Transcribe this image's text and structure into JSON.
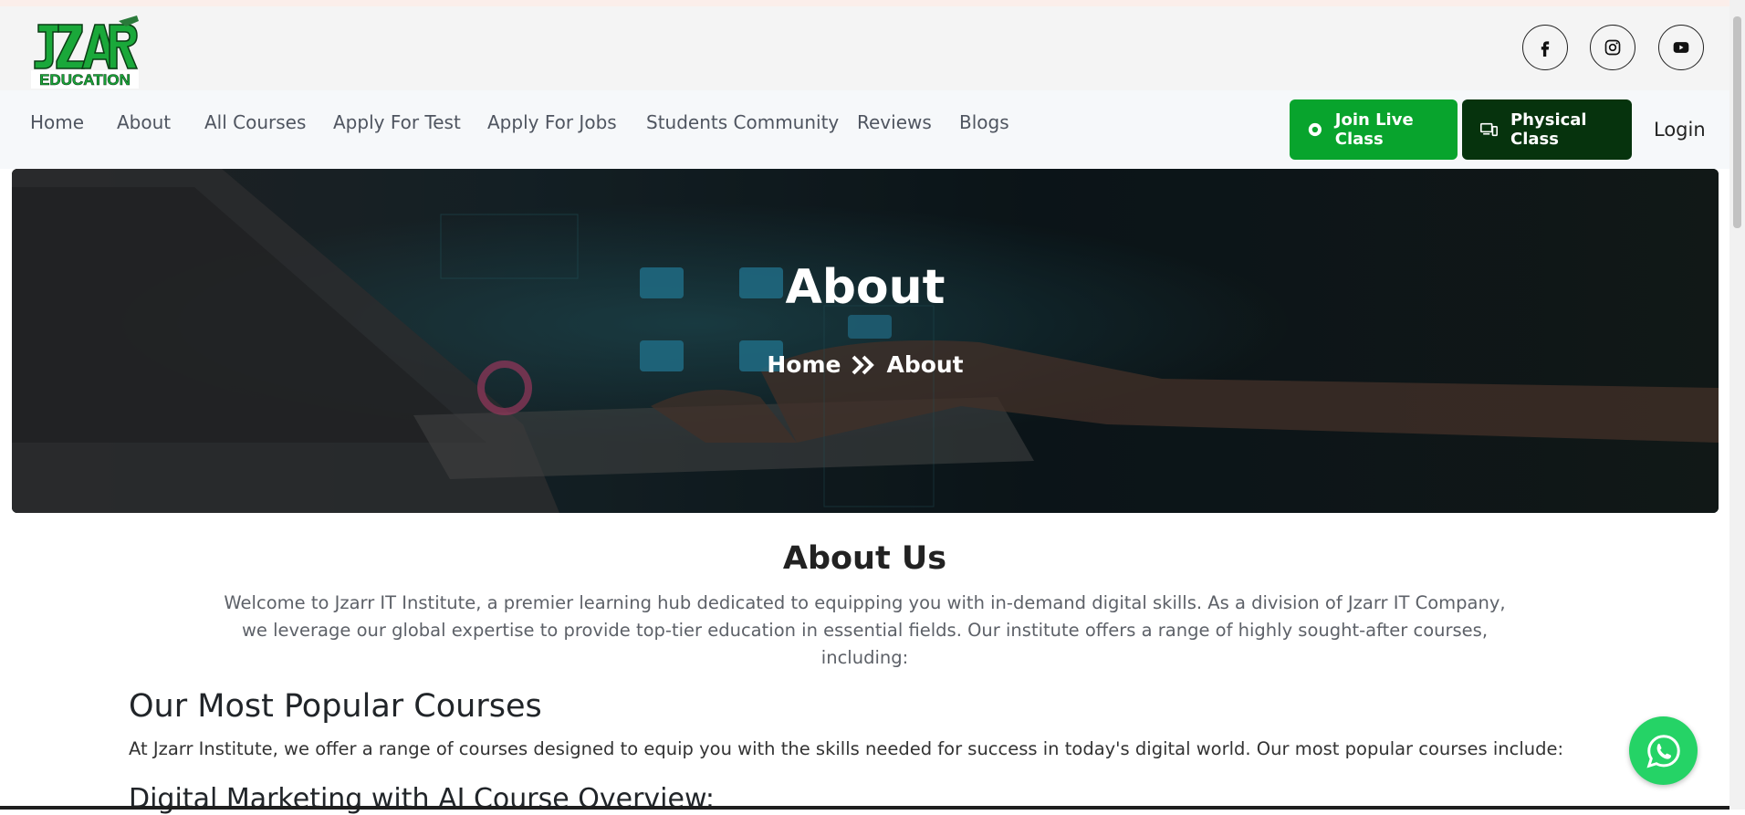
{
  "brand": {
    "logo_main": "JZARR",
    "logo_sub": "EDUCATION"
  },
  "social": [
    {
      "icon": "facebook-icon"
    },
    {
      "icon": "instagram-icon"
    },
    {
      "icon": "youtube-icon"
    }
  ],
  "nav": {
    "items": [
      "Home",
      "About",
      "All Courses",
      "Apply For Test",
      "Apply For Jobs",
      "Students Community",
      "Reviews",
      "Blogs"
    ],
    "live_label": "Join Live Class",
    "physical_label": "Physical Class",
    "login_label": "Login"
  },
  "hero": {
    "title": "About",
    "breadcrumb_home": "Home",
    "breadcrumb_current": "About"
  },
  "about": {
    "title": "About Us",
    "line1": "Welcome to Jzarr IT Institute, a premier learning hub dedicated to equipping you with in-demand digital skills. As a division of Jzarr IT Company,",
    "line2": "we leverage our global expertise to provide top-tier education in essential fields. Our institute offers a range of highly sought-after courses, including:"
  },
  "popular": {
    "title": "Our Most Popular Courses",
    "text": "At Jzarr Institute, we offer a range of courses designed to equip you with the skills needed for success in today's digital world. Our most popular courses include:",
    "course_title": "Digital Marketing with AI Course Overview:"
  },
  "colors": {
    "brand_green": "#08a42d",
    "dark_green": "#06330d",
    "whatsapp": "#25d366"
  }
}
